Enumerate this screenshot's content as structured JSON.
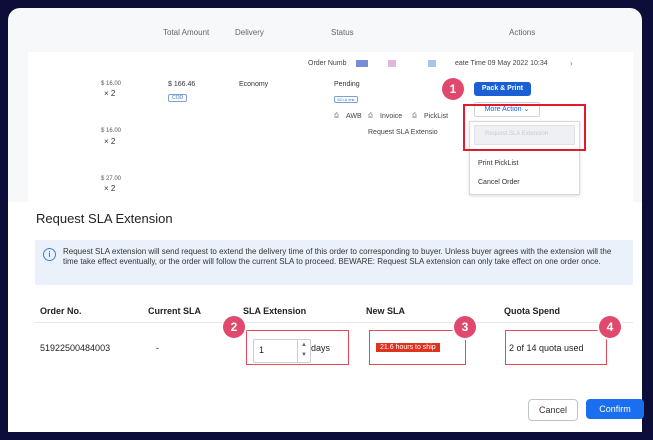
{
  "table_header": {
    "total_amount": "Total Amount",
    "delivery": "Delivery",
    "status": "Status",
    "actions": "Actions"
  },
  "order_row": {
    "order_number_label": "Order Numb",
    "create_time": "eate Time 09 May 2022 10:34",
    "item_prices": [
      "$ 16.00",
      "$ 16.00",
      "$ 27.00"
    ],
    "item_qtys": [
      "× 2",
      "× 2",
      "× 2"
    ],
    "total": "$ 166.46",
    "payment_tag": "COD",
    "delivery": "Economy",
    "status": "Pending",
    "status_tag": "SCI & link",
    "links": {
      "awb": "AWB",
      "invoice": "Invoice",
      "picklist": "PickList"
    },
    "request_sla": "Request SLA Extensio"
  },
  "actions": {
    "pack_print": "Pack & Print",
    "more_action": "More Action"
  },
  "menu": {
    "items": [
      "Request SLA Extension",
      "Print PickList",
      "Cancel Order"
    ]
  },
  "modal": {
    "title": "Request SLA Extension",
    "info": "Request SLA extension will send request to extend the delivery time of this order to corresponding to buyer. Unless buyer agrees with the extension will the time take effect eventually, or the order will follow the current SLA to proceed. BEWARE: Request SLA extension can only take effect on one order once.",
    "columns": [
      "Order No.",
      "Current SLA",
      "SLA Extension",
      "New SLA",
      "Quota Spend"
    ],
    "row": {
      "order_no": "51922500484003",
      "current_sla": "-",
      "extension_value": "1",
      "extension_unit": "days",
      "new_sla": "21.6 hours to ship",
      "quota": "2 of 14 quota used"
    },
    "cancel": "Cancel",
    "confirm": "Confirm"
  },
  "callouts": [
    "1",
    "2",
    "3",
    "4"
  ],
  "colors": {
    "accent": "#1a6ff0",
    "callout": "#e0486e",
    "highlight": "#e11b2e"
  }
}
